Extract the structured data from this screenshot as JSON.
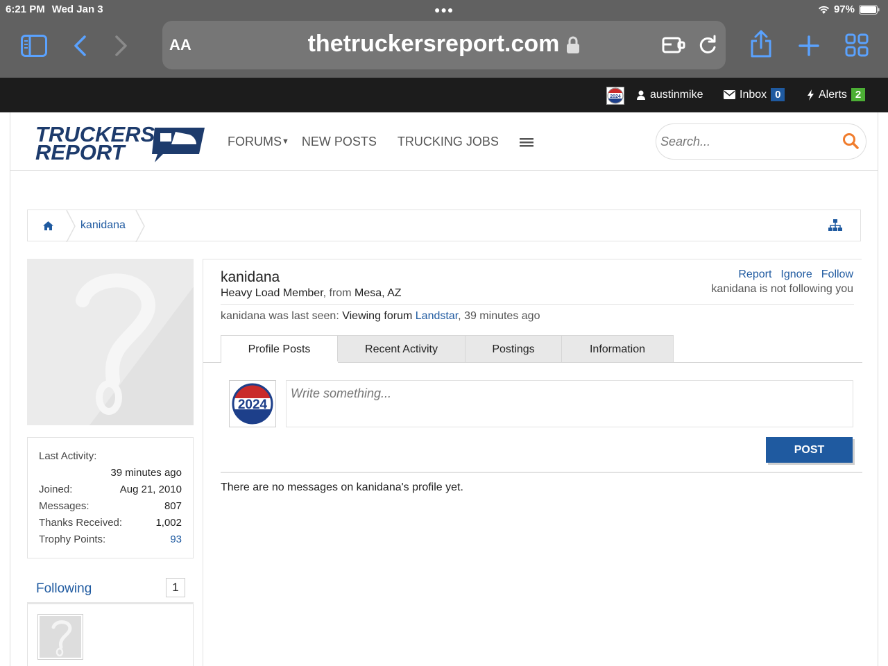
{
  "status_bar": {
    "time": "6:21 PM",
    "day": "Wed Jan 3",
    "battery": "97%"
  },
  "browser": {
    "text_size_label": "AA",
    "url": "thetruckersreport.com"
  },
  "top_bar": {
    "username": "austinmike",
    "inbox_label": "Inbox",
    "inbox_count": "0",
    "alerts_label": "Alerts",
    "alerts_count": "2",
    "inbox_badge_color": "#1f5aa0",
    "alerts_badge_color": "#4caf35"
  },
  "site": {
    "logo_line1": "TRUCKERS",
    "logo_line2": "REPORT",
    "search_placeholder": "Search...",
    "accent": "#1f5aa0",
    "search_icon_color": "#f07c2c"
  },
  "nav": [
    {
      "label": "Forums"
    },
    {
      "label": "New Posts"
    },
    {
      "label": "Trucking Jobs"
    }
  ],
  "breadcrumb": {
    "crumb": "kanidana"
  },
  "profile": {
    "name": "kanidana",
    "title": "Heavy Load Member",
    "from_label": ", from",
    "location": "Mesa, AZ",
    "actions": [
      "Report",
      "Ignore",
      "Follow"
    ],
    "not_following": "kanidana is not following you",
    "last_seen_prefix": "kanidana was last seen:",
    "last_seen_activity": "Viewing forum",
    "last_seen_forum": "Landstar",
    "last_seen_time": ", 39 minutes ago"
  },
  "tabs": [
    {
      "label": "Profile Posts"
    },
    {
      "label": "Recent Activity"
    },
    {
      "label": "Postings"
    },
    {
      "label": "Information"
    }
  ],
  "composer": {
    "placeholder": "Write something...",
    "post_label": "Post",
    "avatar_badge": "2024"
  },
  "empty_message": "There are no messages on kanidana's profile yet.",
  "stats": {
    "last_activity_label": "Last Activity:",
    "last_activity_value": "39 minutes ago",
    "joined_label": "Joined:",
    "joined_value": "Aug 21, 2010",
    "messages_label": "Messages:",
    "messages_value": "807",
    "thanks_label": "Thanks Received:",
    "thanks_value": "1,002",
    "trophy_label": "Trophy Points:",
    "trophy_value": "93"
  },
  "following": {
    "title": "Following",
    "count": "1"
  }
}
